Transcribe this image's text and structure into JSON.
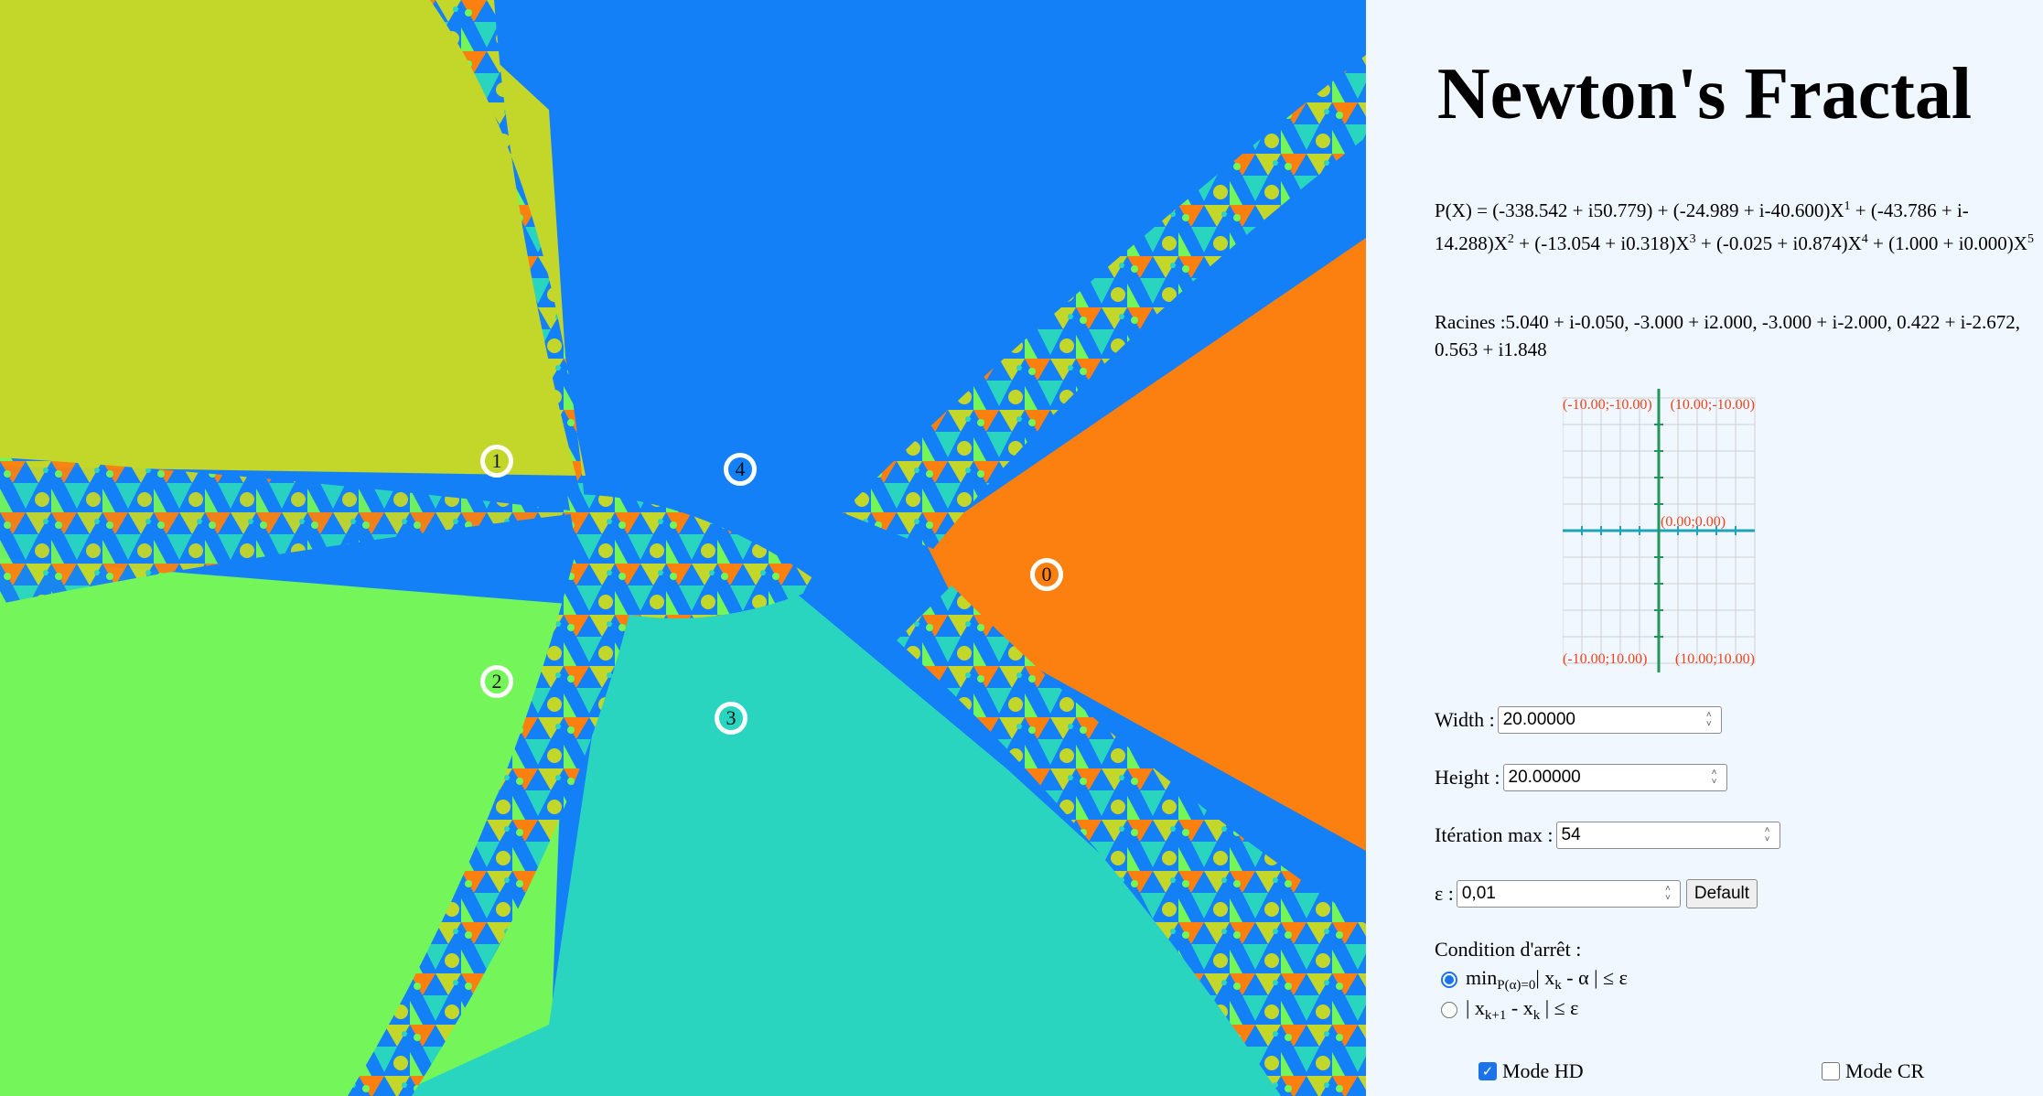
{
  "app": {
    "title": "Newton's Fractal"
  },
  "colors": {
    "basin_0": "#fb8010",
    "basin_1": "#c3d62a",
    "basin_2": "#74f55a",
    "basin_3": "#2ad5c0",
    "basin_4": "#1480f8",
    "panel_bg": "#f0f7ff",
    "label_red": "#e8451f",
    "axis_x": "#1fa3b8",
    "axis_y": "#22955a",
    "accent": "#1a73e8"
  },
  "roots_markers": [
    {
      "label": "0",
      "color": "#fb8010"
    },
    {
      "label": "1",
      "color": "#c3d62a"
    },
    {
      "label": "2",
      "color": "#74f55a"
    },
    {
      "label": "3",
      "color": "#2ad5c0"
    },
    {
      "label": "4",
      "color": "#1480f8"
    }
  ],
  "polynomial": {
    "prefix": "P(X) = ",
    "terms": [
      {
        "coef": "(-338.542 + i50.779)",
        "power": ""
      },
      {
        "coef": "(-24.989 + i-40.600)X",
        "power": "1"
      },
      {
        "coef": "(-43.786 + i-14.288)X",
        "power": "2"
      },
      {
        "coef": "(-13.054 + i0.318)X",
        "power": "3"
      },
      {
        "coef": "(-0.025 + i0.874)X",
        "power": "4"
      },
      {
        "coef": "(1.000 + i0.000)X",
        "power": "5"
      }
    ]
  },
  "roots_text": "Racines :5.040 + i-0.050, -3.000 + i2.000, -3.000 + i-2.000, 0.422 + i-2.672, 0.563 + i1.848",
  "plane_preview": {
    "top_left": "(-10.00;-10.00)",
    "top_right": "(10.00;-10.00)",
    "center": "(0.00;0.00)",
    "bottom_left": "(-10.00;10.00)",
    "bottom_right": "(10.00;10.00)"
  },
  "fields": {
    "width": {
      "label": "Width :",
      "value": "20.00000"
    },
    "height": {
      "label": "Height :",
      "value": "20.00000"
    },
    "iterations": {
      "label": "Itération max :",
      "value": "54"
    },
    "epsilon": {
      "label": "ε :",
      "value": "0,01"
    },
    "default_button": "Default"
  },
  "stop_condition": {
    "title": "Condition d'arrêt :",
    "option1": {
      "pre": "min",
      "sub": "P(α)=0",
      "post": "| x",
      "sub2": "k",
      "tail": " - α | ≤ ε",
      "checked": true
    },
    "option2": {
      "pre": "| x",
      "sub": "k+1",
      "post": " - x",
      "sub2": "k",
      "tail": " | ≤ ε",
      "checked": false
    }
  },
  "modes": {
    "hd": {
      "label": "Mode HD",
      "checked": true
    },
    "cr": {
      "label": "Mode CR",
      "checked": false
    }
  }
}
